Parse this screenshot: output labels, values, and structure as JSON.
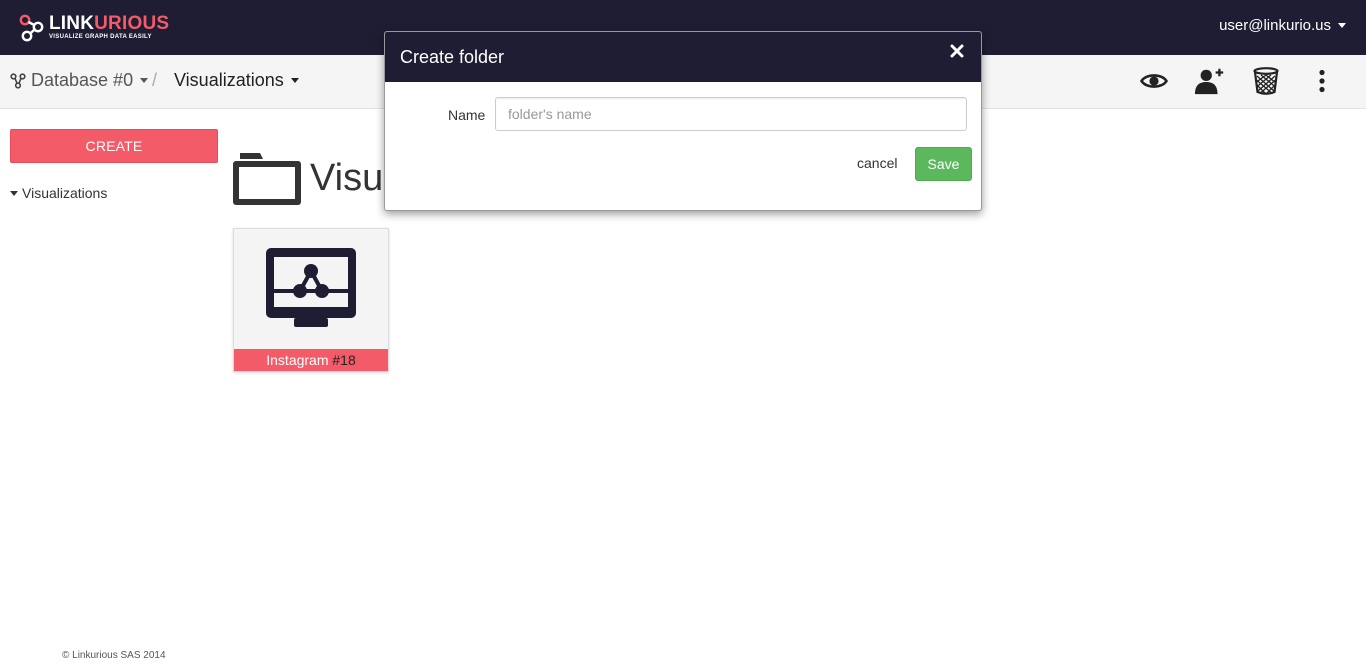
{
  "brand": {
    "name_part1": "LINK",
    "name_part2": "URIOUS",
    "tagline": "VISUALIZE GRAPH DATA EASILY",
    "accent_color": "#f45b69",
    "nav_color": "#1f1d33"
  },
  "topbar": {
    "user_email": "user@linkurio.us"
  },
  "subbar": {
    "database_label": "Database #0",
    "separator": "/",
    "visualizations_label": "Visualizations",
    "icons": [
      "eye-icon",
      "add-user-icon",
      "trash-icon",
      "more-vertical-icon"
    ]
  },
  "sidebar": {
    "create_label": "CREATE",
    "tree": [
      {
        "label": "Visualizations",
        "expanded": true
      }
    ]
  },
  "main": {
    "title": "Visualizations",
    "cards": [
      {
        "name": "Instagram",
        "id": "#18",
        "icon": "visualization-monitor-icon"
      }
    ]
  },
  "modal": {
    "title": "Create folder",
    "name_label": "Name",
    "name_placeholder": "folder's name",
    "name_value": "",
    "cancel_label": "cancel",
    "save_label": "Save",
    "save_color": "#5cb85c"
  },
  "footer": {
    "copyright": "© Linkurious SAS 2014"
  }
}
